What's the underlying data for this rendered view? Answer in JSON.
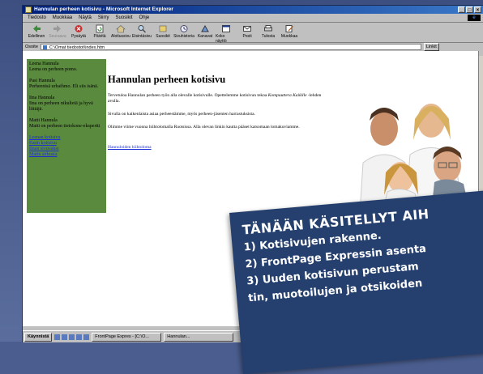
{
  "window": {
    "title": "Hannulan perheen kotisivu - Microsoft Internet Explorer",
    "controls": [
      "_",
      "□",
      "×"
    ]
  },
  "menu": [
    "Tiedosto",
    "Muokkaa",
    "Näytä",
    "Siirry",
    "Suosikit",
    "Ohje"
  ],
  "toolbar": [
    {
      "label": "Edellinen",
      "icon": "back-icon",
      "enabled": true
    },
    {
      "label": "Seuraava",
      "icon": "forward-icon",
      "enabled": false
    },
    {
      "label": "Pysäytä",
      "icon": "stop-icon",
      "enabled": true
    },
    {
      "label": "Päivitä",
      "icon": "refresh-icon",
      "enabled": true
    },
    {
      "label": "Aloitussivu",
      "icon": "home-icon",
      "enabled": true
    },
    {
      "label": "Etsintäsivu",
      "icon": "search-icon",
      "enabled": true
    },
    {
      "label": "Suosikit",
      "icon": "favorites-icon",
      "enabled": true
    },
    {
      "label": "Sivuhistoria",
      "icon": "history-icon",
      "enabled": true
    },
    {
      "label": "Kanavat",
      "icon": "channels-icon",
      "enabled": true
    },
    {
      "label": "Koko näyttö",
      "icon": "fullscreen-icon",
      "enabled": true
    },
    {
      "label": "Posti",
      "icon": "mail-icon",
      "enabled": true
    },
    {
      "label": "Tulosta",
      "icon": "print-icon",
      "enabled": true
    },
    {
      "label": "Muokkaa",
      "icon": "edit-icon",
      "enabled": true
    }
  ],
  "address": {
    "label": "Osoite",
    "value": "C:\\Omat tiedostot\\index.htm",
    "links_label": "Linkit"
  },
  "sidebar": {
    "members": [
      {
        "name": "Leena Hannula",
        "desc": "Leena on perheen pomo."
      },
      {
        "name": "Pasi Hannula",
        "desc": "Perheenisä urhaihmo. Eli siis isänä."
      },
      {
        "name": "Iina Hannula",
        "desc": "Iina on perheen nikultetä ja hyvä liittäjä."
      },
      {
        "name": "Matti Hannula",
        "desc": "Matti on perheen tietokone-ekspertti"
      }
    ],
    "links": [
      "Leenan kotisivu",
      "Pasin kotisivu",
      "Iinan sivuvaksi",
      "Matin sirkusta"
    ]
  },
  "main": {
    "heading": "Hannulan perheen kotisivu",
    "p1_a": "Tervetuloa Hannulan perheen työn alla olevalle kotisivulle. Opettelemme kotisivun tekoa ",
    "p1_em": "Kompuuttera Kaikille",
    "p1_b": " -lehden avulla.",
    "p2": "Sivulla on kaikenlaista asiaa perheestämme, myös perheen-jäsenten harrastuksista.",
    "p3": "Olimme viime vuonna hiihtolomalla Ruotsissa. Alla olevan linkin kautta pääset katsomaan lomakuviamme.",
    "link": "Hannuloiden hiihtoloma"
  },
  "taskbar": {
    "start": "Käynnistä",
    "task1": "FrontPage Expres - [C:\\O...",
    "task2": "Hannulan..."
  },
  "overlay": {
    "title": "TÄNÄÄN KÄSITELLYT AIH",
    "lines": [
      "1) Kotisivujen rakenne.",
      "2) FrontPage Expressin asenta",
      "3) Uuden kotisivun perustam",
      "tin, muotoilujen ja otsikoiden"
    ]
  },
  "colors": {
    "sidebar_bg": "#5a8a3e",
    "overlay_bg": "#25406e",
    "titlebar": "#00207a"
  }
}
